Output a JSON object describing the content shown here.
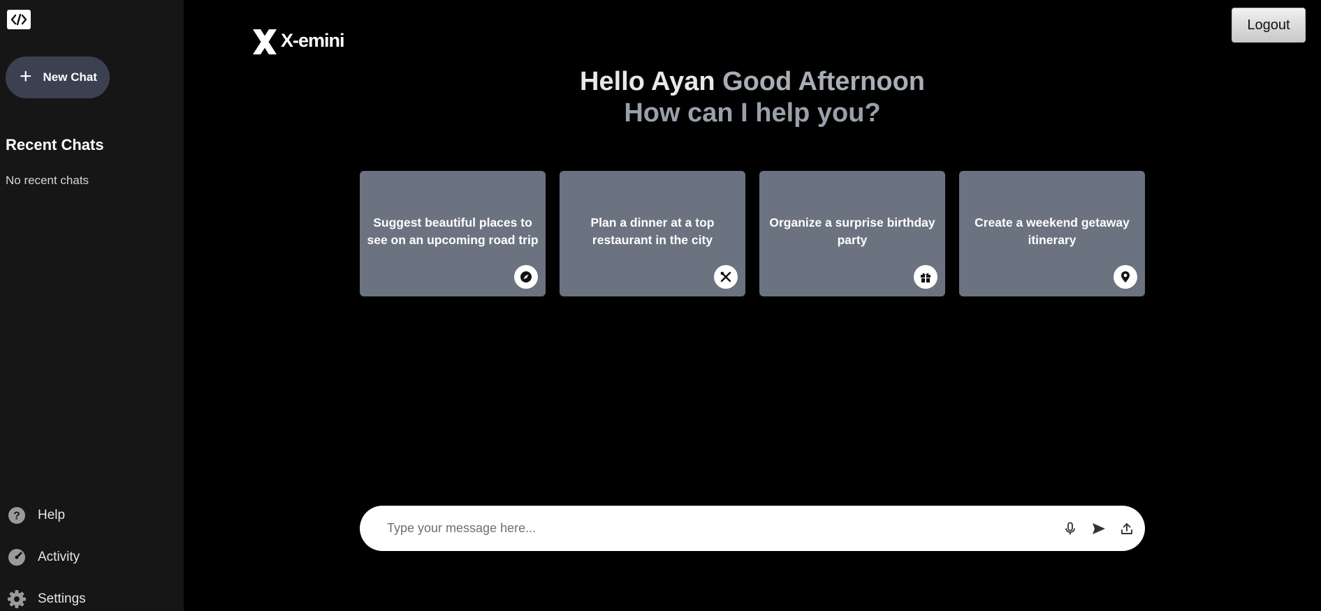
{
  "sidebar": {
    "logo_icon": "code-brackets-icon",
    "new_chat_label": "New Chat",
    "recent_title": "Recent Chats",
    "recent_empty": "No recent chats",
    "links": [
      {
        "label": "Help",
        "icon": "help-icon"
      },
      {
        "label": "Activity",
        "icon": "activity-icon"
      },
      {
        "label": "Settings",
        "icon": "settings-icon"
      }
    ]
  },
  "header": {
    "brand": "X-emini",
    "logout_label": "Logout"
  },
  "greeting": {
    "line1_start": "Hello Ayan ",
    "line1_end": "Good Afternoon",
    "line2": "How can I help you?"
  },
  "cards": [
    {
      "text": "Suggest beautiful places to see on an upcoming road trip",
      "icon": "compass-icon"
    },
    {
      "text": "Plan a dinner at a top restaurant in the city",
      "icon": "utensils-icon"
    },
    {
      "text": "Organize a surprise birthday party",
      "icon": "gift-icon"
    },
    {
      "text": "Create a weekend getaway itinerary",
      "icon": "location-pin-icon"
    }
  ],
  "composer": {
    "placeholder": "Type your message here...",
    "value": ""
  },
  "colors": {
    "sidebar_bg": "#161616",
    "main_bg": "#000000",
    "card_bg": "#6b7280",
    "new_chat_bg": "#3b4150"
  }
}
